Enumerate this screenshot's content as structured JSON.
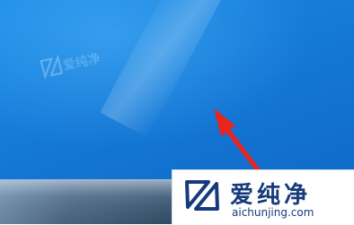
{
  "watermark": {
    "faint_text": "爱纯净"
  },
  "logo": {
    "brand_cn": "爱纯净",
    "url": "aichunjing.com",
    "mark_icon": "aichunjing-logo-icon"
  },
  "annotation": {
    "arrow_icon": "red-pointer-arrow-icon",
    "arrow_color": "#e8241e"
  },
  "colors": {
    "desktop_blue": "#1478d6",
    "taskbar": "#3f5770",
    "logo_blue": "#163a7a"
  }
}
